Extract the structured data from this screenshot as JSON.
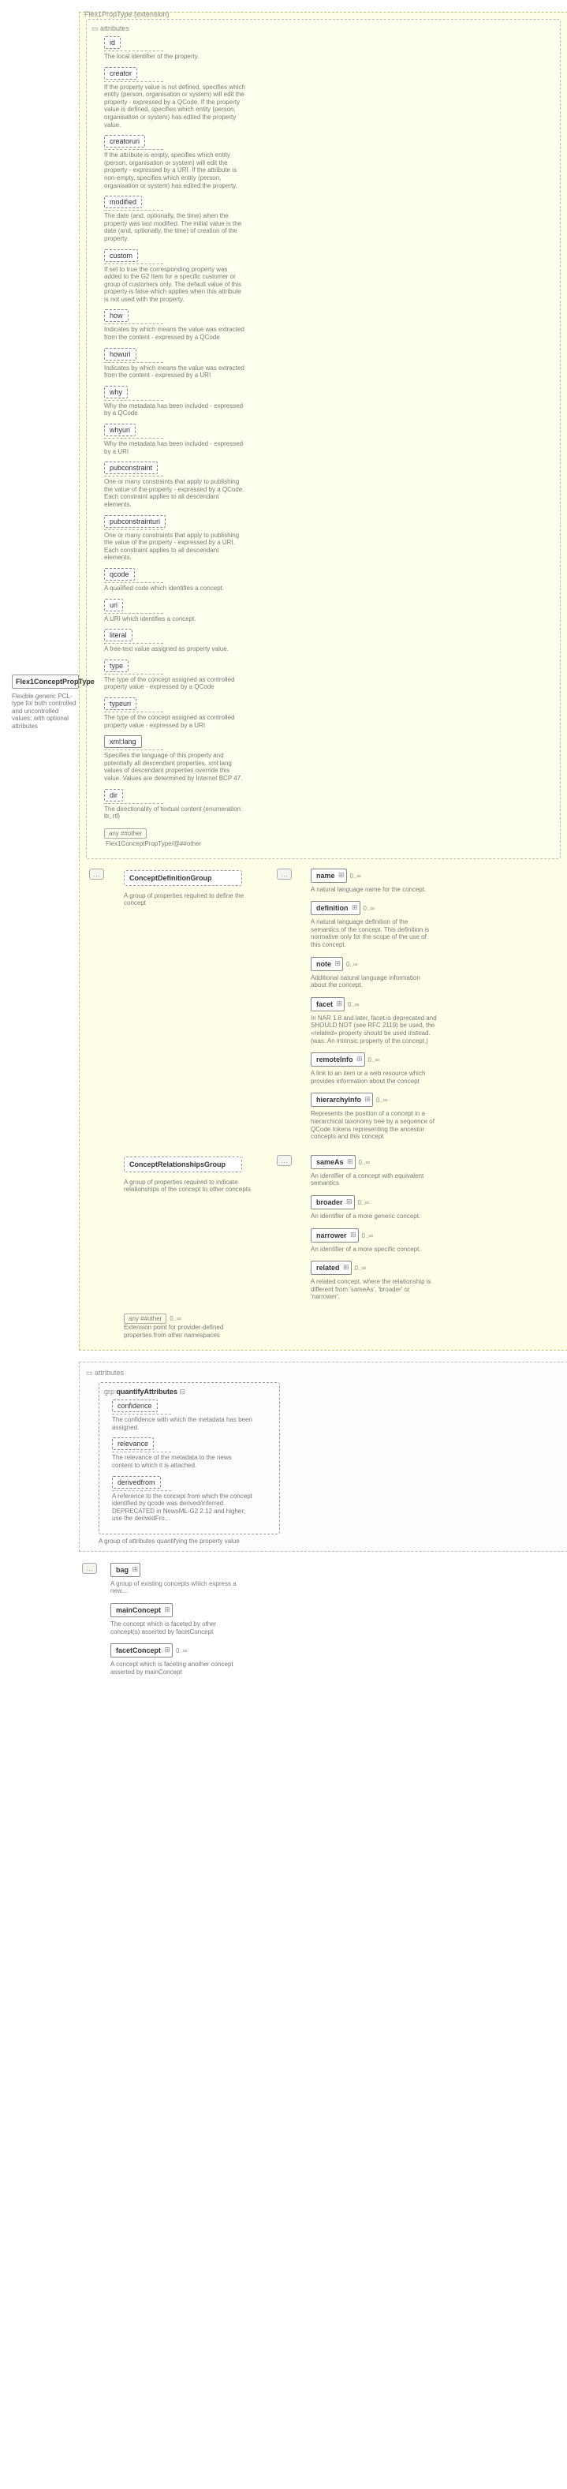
{
  "root": {
    "title": "Flex1ConceptPropType",
    "desc": "Flexible generic PCL-type for both controlled and uncontrolled values; with optional attributes"
  },
  "extLabel": "Flex1PropType (extension)",
  "attrsHead": "attributes",
  "attrs": [
    {
      "name": "id",
      "desc": "The local identifier of the property."
    },
    {
      "name": "creator",
      "desc": "If the property value is not defined, specifies which entity (person, organisation or system) will edit the property - expressed by a QCode. If the property value is defined, specifies which entity (person, organisation or system) has edited the property value."
    },
    {
      "name": "creatoruri",
      "desc": "If the attribute is empty, specifies which entity (person, organisation or system) will edit the property - expressed by a URI. If the attribute is non-empty, specifies which entity (person, organisation or system) has edited the property."
    },
    {
      "name": "modified",
      "desc": "The date (and, optionally, the time) when the property was last modified. The initial value is the date (and, optionally, the time) of creation of the property."
    },
    {
      "name": "custom",
      "desc": "If set to true the corresponding property was added to the G2 Item for a specific customer or group of customers only. The default value of this property is false which applies when this attribute is not used with the property."
    },
    {
      "name": "how",
      "desc": "Indicates by which means the value was extracted from the content - expressed by a QCode"
    },
    {
      "name": "howuri",
      "desc": "Indicates by which means the value was extracted from the content - expressed by a URI"
    },
    {
      "name": "why",
      "desc": "Why the metadata has been included - expressed by a QCode"
    },
    {
      "name": "whyuri",
      "desc": "Why the metadata has been included - expressed by a URI"
    },
    {
      "name": "pubconstraint",
      "desc": "One or many constraints that apply to publishing the value of the property - expressed by a QCode. Each constraint applies to all descendant elements."
    },
    {
      "name": "pubconstrainturi",
      "desc": "One or many constraints that apply to publishing the value of the property - expressed by a URI. Each constraint applies to all descendant elements."
    },
    {
      "name": "qcode",
      "desc": "A qualified code which identifies a concept."
    },
    {
      "name": "uri",
      "desc": "A URI which identifies a concept."
    },
    {
      "name": "literal",
      "desc": "A free-text value assigned as property value."
    },
    {
      "name": "type",
      "desc": "The type of the concept assigned as controlled property value - expressed by a QCode"
    },
    {
      "name": "typeuri",
      "desc": "The type of the concept assigned as controlled property value - expressed by a URI"
    },
    {
      "name": "xml:lang",
      "desc": "Specifies the language of this property and potentially all descendant properties. xml:lang values of descendant properties override this value. Values are determined by Internet BCP 47.",
      "solid": true
    },
    {
      "name": "dir",
      "desc": "The directionality of textual content (enumeration: ltr, rtl)"
    }
  ],
  "ifother": {
    "tag": "any ##other",
    "sub": "Flex1ConceptPropType/@##other"
  },
  "groups": {
    "def": {
      "title": "ConceptDefinitionGroup",
      "desc": "A group of properties required to define the concept"
    },
    "rel": {
      "title": "ConceptRelationshipsGroup",
      "desc": "A group of properties required to indicate relationships of the concept to other concepts"
    }
  },
  "elems1": [
    {
      "name": "name",
      "desc": "A natural language name for the concept."
    },
    {
      "name": "definition",
      "desc": "A natural language definition of the semantics of the concept. This definition is normative only for the scope of the use of this concept."
    },
    {
      "name": "note",
      "desc": "Additional natural language information about the concept."
    },
    {
      "name": "facet",
      "desc": "In NAR 1.8 and later, facet is deprecated and SHOULD NOT (see RFC 2119) be used, the «related» property should be used instead.(was: An intrinsic property of the concept.)"
    },
    {
      "name": "remoteInfo",
      "desc": "A link to an item or a web resource which provides information about the concept"
    },
    {
      "name": "hierarchyInfo",
      "desc": "Represents the position of a concept in a hierarchical taxonomy tree by a sequence of QCode tokens representing the ancestor concepts and this concept"
    }
  ],
  "elems2": [
    {
      "name": "sameAs",
      "desc": "An identifier of a concept with equivalent semantics"
    },
    {
      "name": "broader",
      "desc": "An identifier of a more generic concept."
    },
    {
      "name": "narrower",
      "desc": "An identifier of a more specific concept."
    },
    {
      "name": "related",
      "desc": "A related concept, where the relationship is different from 'sameAs', 'broader' or 'narrower'."
    }
  ],
  "ifother2": {
    "tag": "any ##other",
    "occ": "0..∞",
    "desc": "Extension point for provider-defined properties from other namespaces"
  },
  "sect2": {
    "attrsHead": "attributes",
    "grpTag": "grp",
    "grpTitle": "quantifyAttributes",
    "items": [
      {
        "name": "confidence",
        "desc": "The confidence with which the metadata has been assigned."
      },
      {
        "name": "relevance",
        "desc": "The relevance of the metadata to the news content to which it is attached."
      },
      {
        "name": "derivedfrom",
        "desc": "A reference to the concept from which the concept identified by qcode was derived/inferred. DEPRECATED in NewsML-G2 2.12 and higher; use the derivedFro…"
      }
    ],
    "grpDesc": "A group of attributes quantifying the property value"
  },
  "bottom": [
    {
      "name": "bag",
      "desc": "A group of existing concepts which express a new…"
    },
    {
      "name": "mainConcept",
      "desc": "The concept which is faceted by other concept(s) asserted by facetConcept"
    },
    {
      "name": "facetConcept",
      "occ": "0..∞",
      "desc": "A concept which is faceting another concept asserted by mainConcept"
    }
  ],
  "connSym": "…"
}
